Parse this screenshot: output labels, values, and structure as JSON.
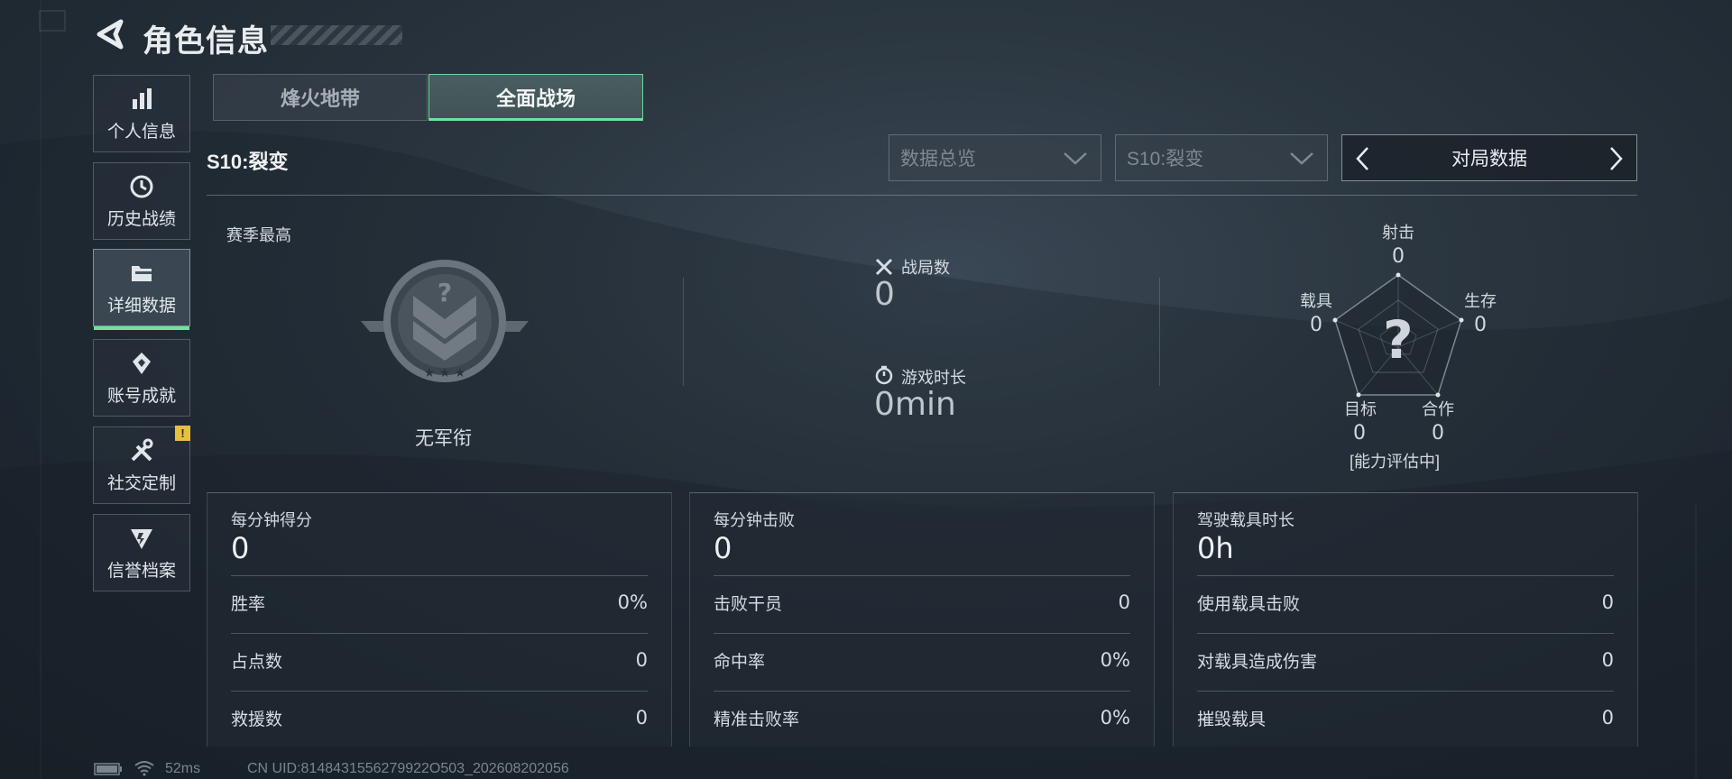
{
  "header": {
    "title": "角色信息"
  },
  "sidebar": {
    "items": [
      {
        "label": "个人信息",
        "icon": "bar-chart-icon"
      },
      {
        "label": "历史战绩",
        "icon": "history-icon"
      },
      {
        "label": "详细数据",
        "icon": "folder-icon",
        "active": true
      },
      {
        "label": "账号成就",
        "icon": "achievement-icon"
      },
      {
        "label": "社交定制",
        "icon": "tools-icon",
        "badge": "!"
      },
      {
        "label": "信誉档案",
        "icon": "credit-shield-icon"
      }
    ]
  },
  "tabs": [
    {
      "label": "烽火地带",
      "active": false
    },
    {
      "label": "全面战场",
      "active": true
    }
  ],
  "season_label": "S10:裂变",
  "filters": {
    "data_overview": "数据总览",
    "season": "S10:裂变",
    "match_data": "对局数据"
  },
  "rank": {
    "section_title": "赛季最高",
    "rank_name": "无军衔"
  },
  "summary": {
    "matches_label": "战局数",
    "matches_value": "0",
    "playtime_label": "游戏时长",
    "playtime_value": "0min"
  },
  "radar": {
    "axes": [
      {
        "label": "射击",
        "value": "0"
      },
      {
        "label": "生存",
        "value": "0"
      },
      {
        "label": "合作",
        "value": "0"
      },
      {
        "label": "目标",
        "value": "0"
      },
      {
        "label": "载具",
        "value": "0"
      }
    ],
    "center_symbol": "?",
    "status": "[能力评估中]"
  },
  "panels": [
    {
      "title": "每分钟得分",
      "value": "0",
      "rows": [
        {
          "label": "胜率",
          "value": "0%"
        },
        {
          "label": "占点数",
          "value": "0"
        },
        {
          "label": "救援数",
          "value": "0"
        }
      ]
    },
    {
      "title": "每分钟击败",
      "value": "0",
      "rows": [
        {
          "label": "击败干员",
          "value": "0"
        },
        {
          "label": "命中率",
          "value": "0%"
        },
        {
          "label": "精准击败率",
          "value": "0%"
        }
      ]
    },
    {
      "title": "驾驶载具时长",
      "value": "0h",
      "rows": [
        {
          "label": "使用载具击败",
          "value": "0"
        },
        {
          "label": "对载具造成伤害",
          "value": "0"
        },
        {
          "label": "摧毁载具",
          "value": "0"
        }
      ]
    }
  ],
  "footer": {
    "ping": "52ms",
    "uid": "CN UID:8148431556279922O503_202608202056"
  },
  "colors": {
    "accent": "#6de3a1",
    "badge": "#e6c13c"
  }
}
